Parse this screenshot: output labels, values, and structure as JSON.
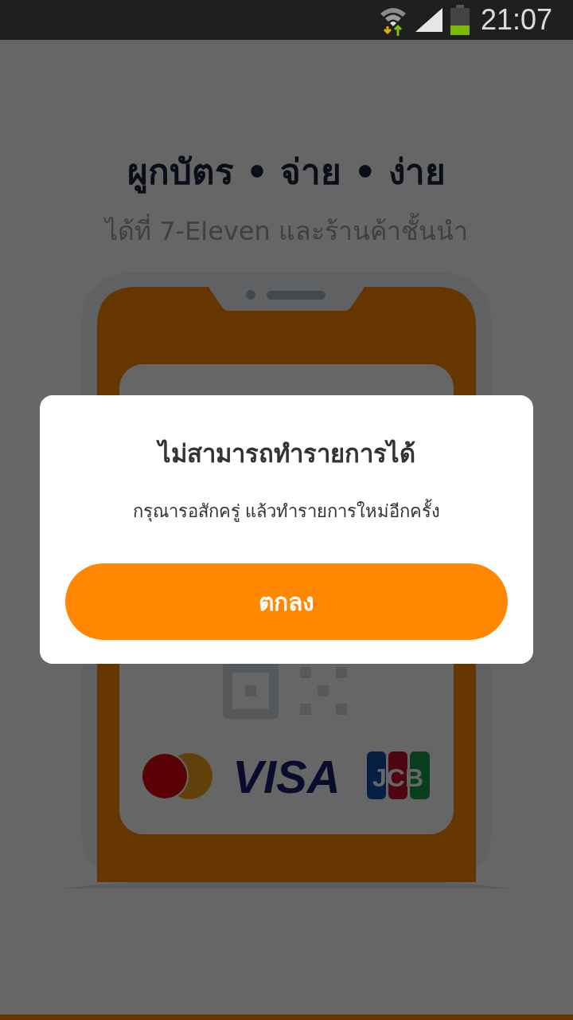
{
  "status_bar": {
    "time": "21:07"
  },
  "hero": {
    "title": "ผูกบัตร • จ่าย • ง่าย",
    "subtitle": "ได้ที่ 7-Eleven และร้านค้าชั้นนำ"
  },
  "card_brands": [
    {
      "kind": "mastercard"
    },
    {
      "kind": "visa",
      "label": "VISA"
    },
    {
      "kind": "jcb",
      "label": "JCB"
    }
  ],
  "dialog": {
    "title": "ไม่สามารถทำรายการได้",
    "message": "กรุณารอสักครู่ แล้วทำรายการใหม่อีกครั้ง",
    "button": "ตกลง"
  }
}
